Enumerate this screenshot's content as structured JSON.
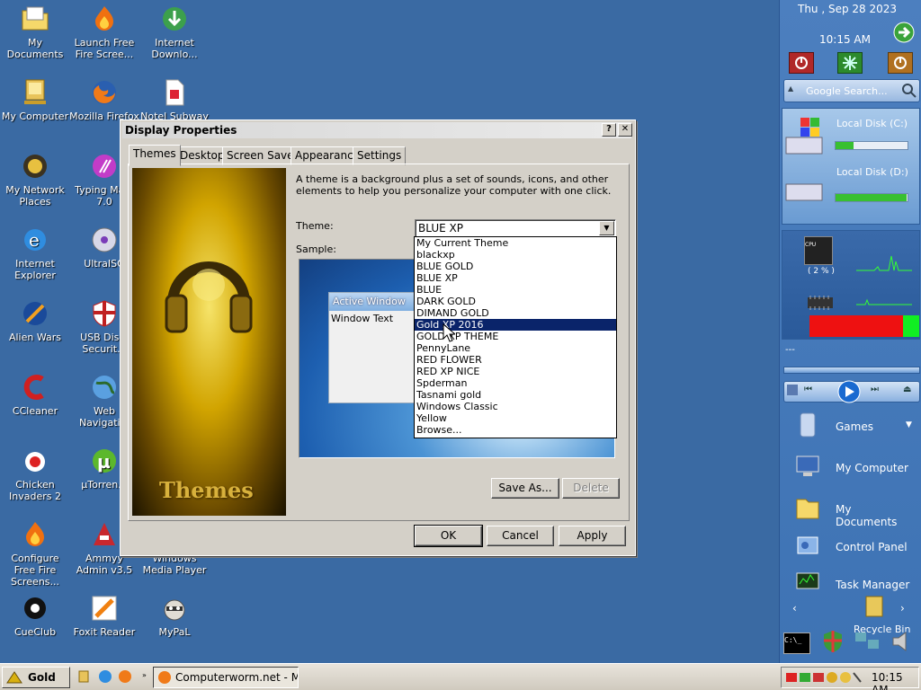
{
  "desktop": {
    "icons": [
      {
        "label": "My Documents"
      },
      {
        "label": "Launch Free Fire Scree..."
      },
      {
        "label": "Internet Downlo..."
      },
      {
        "label": "My Computer"
      },
      {
        "label": "Mozilla Firefox"
      },
      {
        "label": "Notel Subway"
      },
      {
        "label": "My Network Places"
      },
      {
        "label": "Typing Ma... 7.0"
      },
      {
        "label": "Internet Explorer"
      },
      {
        "label": "UltraISO"
      },
      {
        "label": "Alien Wars"
      },
      {
        "label": "USB Dis... Securit..."
      },
      {
        "label": "CCleaner"
      },
      {
        "label": "Web Navigati..."
      },
      {
        "label": "Chicken Invaders 2"
      },
      {
        "label": "µTorren..."
      },
      {
        "label": "Configure Free Fire Screens..."
      },
      {
        "label": "Ammyy Admin v3.5"
      },
      {
        "label": "Windows Media Player"
      },
      {
        "label": "CueClub"
      },
      {
        "label": "Foxit Reader"
      },
      {
        "label": "MyPaL"
      }
    ]
  },
  "sidebar": {
    "date": "Thu , Sep 28 2023",
    "time": "10:15 AM",
    "search_placeholder": "Google Search...",
    "disk_c": {
      "label": "Local Disk (C:)",
      "fill": 0.25
    },
    "disk_d": {
      "label": "Local Disk (D:)",
      "fill": 0.99
    },
    "cpu_label": "CPU",
    "cpu_percent": "( 2 % )",
    "media_label": "---",
    "items": [
      {
        "label": "Games"
      },
      {
        "label": "My Computer"
      },
      {
        "label": "My Documents"
      },
      {
        "label": "Control Panel"
      },
      {
        "label": "Task Manager"
      },
      {
        "label": "Recycle Bin"
      }
    ]
  },
  "dialog": {
    "title": "Display Properties",
    "help_btn": "?",
    "close_btn": "✕",
    "tabs": [
      {
        "label": "Themes",
        "active": true
      },
      {
        "label": "Desktop"
      },
      {
        "label": "Screen Saver"
      },
      {
        "label": "Appearance"
      },
      {
        "label": "Settings"
      }
    ],
    "description": "A theme is a background plus a set of sounds, icons, and other elements to help you personalize your computer with one click.",
    "theme_label": "Theme:",
    "theme_value": "BLUE XP",
    "sample_label": "Sample:",
    "sample_active_window": "Active Window",
    "sample_window_text": "Window Text",
    "preview_caption": "Themes",
    "save_as": "Save As...",
    "delete": "Delete",
    "ok": "OK",
    "cancel": "Cancel",
    "apply": "Apply",
    "dropdown_options": [
      "My Current Theme",
      "blackxp",
      "BLUE GOLD",
      "BLUE XP",
      "BLUE",
      "DARK GOLD",
      "DIMAND GOLD",
      "Gold XP 2016",
      "GOLD XP THEME",
      "PennyLane",
      "RED FLOWER",
      "RED XP NICE",
      "Spderman",
      "Tasnami  gold",
      "Windows Classic",
      "Yellow",
      "Browse..."
    ],
    "highlighted_option": "Gold XP 2016"
  },
  "taskbar": {
    "start_label": "Gold XP",
    "task_label": "Computerworm.net - Mo...",
    "clock": "10:15 AM"
  }
}
